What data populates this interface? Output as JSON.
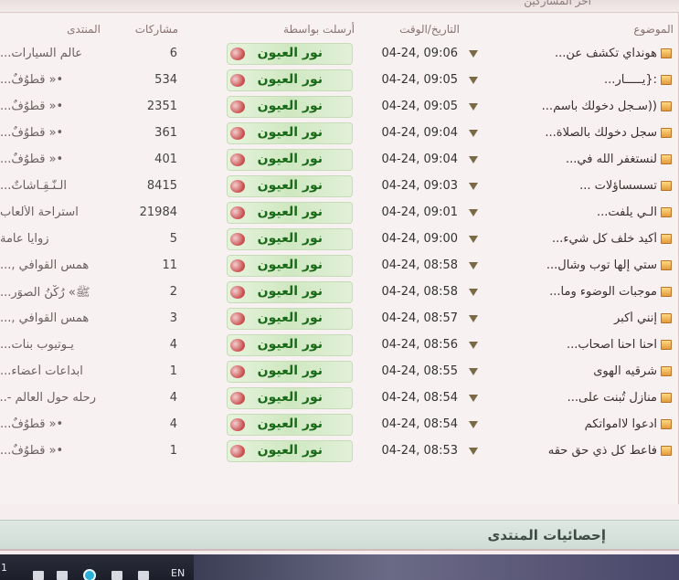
{
  "page": {
    "top_title": "آخر المشاركين"
  },
  "columns": {
    "topic": "الموضوع",
    "date": "التاريخ/الوقت",
    "sender": "أرسلت بواسطة",
    "posts": "مشاركات",
    "forum": "المنتدى"
  },
  "rows": [
    {
      "topic": "هونداي تكشف عن...",
      "date": "04-24, 09:06",
      "sender": "نور العيون",
      "posts": "6",
      "forum": "عالم السيارات..."
    },
    {
      "topic": ":{يـــــآر...",
      "date": "04-24, 09:05",
      "sender": "نور العيون",
      "posts": "534",
      "forum": "•« قطوُفٌ..."
    },
    {
      "topic": "((سـجل دخولك بأسم...",
      "date": "04-24, 09:05",
      "sender": "نور العيون",
      "posts": "2351",
      "forum": "•« قطوُفٌ..."
    },
    {
      "topic": "سجل دخولك بالصلاة...",
      "date": "04-24, 09:04",
      "sender": "نور العيون",
      "posts": "361",
      "forum": "•« قطوُفٌ..."
    },
    {
      "topic": "لنستغفر الله في...",
      "date": "04-24, 09:04",
      "sender": "نور العيون",
      "posts": "401",
      "forum": "•« قطوُفٌ..."
    },
    {
      "topic": "تسسساؤلات ...",
      "date": "04-24, 09:03",
      "sender": "نور العيون",
      "posts": "8415",
      "forum": "الـنّـقِـآشآتٌ..."
    },
    {
      "topic": "الـي يلفت...",
      "date": "04-24, 09:01",
      "sender": "نور العيون",
      "posts": "21984",
      "forum": "استراحة الألعاب"
    },
    {
      "topic": "أكيد خلف كل شيء...",
      "date": "04-24, 09:00",
      "sender": "نور العيون",
      "posts": "5",
      "forum": "زوايا عامة"
    },
    {
      "topic": "ستي إلها توب وشال...",
      "date": "04-24, 08:58",
      "sender": "نور العيون",
      "posts": "11",
      "forum": "همس القوافي ,..."
    },
    {
      "topic": "موجبات الوضوء وما...",
      "date": "04-24, 08:58",
      "sender": "نور العيون",
      "posts": "2",
      "forum": "ﷺ» رُكْنُ الصوَر..."
    },
    {
      "topic": "إنني أكبر",
      "date": "04-24, 08:57",
      "sender": "نور العيون",
      "posts": "3",
      "forum": "همس القوافي ,..."
    },
    {
      "topic": "احنا احنا اصحاب...",
      "date": "04-24, 08:56",
      "sender": "نور العيون",
      "posts": "4",
      "forum": "يـوتيوب بنات..."
    },
    {
      "topic": "شرقيه الهوى",
      "date": "04-24, 08:55",
      "sender": "نور العيون",
      "posts": "1",
      "forum": "ابداعات أعضاء..."
    },
    {
      "topic": "منازل تُبنت على...",
      "date": "04-24, 08:54",
      "sender": "نور العيون",
      "posts": "4",
      "forum": "رحله حول العالم -..."
    },
    {
      "topic": "ادعوا لاامواتكم",
      "date": "04-24, 08:54",
      "sender": "نور العيون",
      "posts": "4",
      "forum": "•« قطوُفٌ..."
    },
    {
      "topic": "فأعط كل ذي حق حقه",
      "date": "04-24, 08:53",
      "sender": "نور العيون",
      "posts": "1",
      "forum": "•« قطوُفٌ..."
    }
  ],
  "stats": {
    "title": "إحصائيات المنتدى"
  },
  "taskbar": {
    "lang": "EN",
    "left_digit": "1"
  },
  "icons": {
    "topic": "folder-icon",
    "sort": "triangle-down-icon",
    "sender_flag": "flag-icon"
  }
}
